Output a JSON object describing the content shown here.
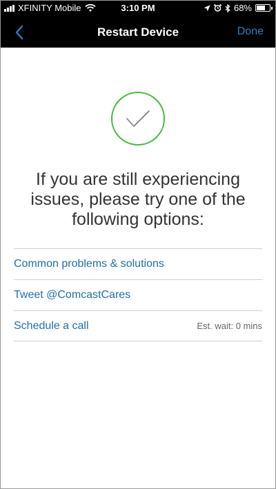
{
  "status_bar": {
    "carrier": "XFINITY Mobile",
    "time": "3:10 PM",
    "battery": "68%",
    "battery_level": 0.68
  },
  "nav": {
    "back_icon": "chevron-left-icon",
    "title": "Restart Device",
    "done_label": "Done"
  },
  "success": {
    "icon": "checkmark-icon",
    "color": "#47b83d"
  },
  "message": "If you are still experiencing issues, please try one of the following options:",
  "options": [
    {
      "label": "Common problems & solutions",
      "meta": ""
    },
    {
      "label": "Tweet @ComcastCares",
      "meta": ""
    },
    {
      "label": "Schedule a call",
      "meta": "Est. wait: 0 mins"
    }
  ],
  "colors": {
    "accent": "#2b7fc9",
    "link": "#1f6fa8",
    "bar_background": "#000000"
  }
}
